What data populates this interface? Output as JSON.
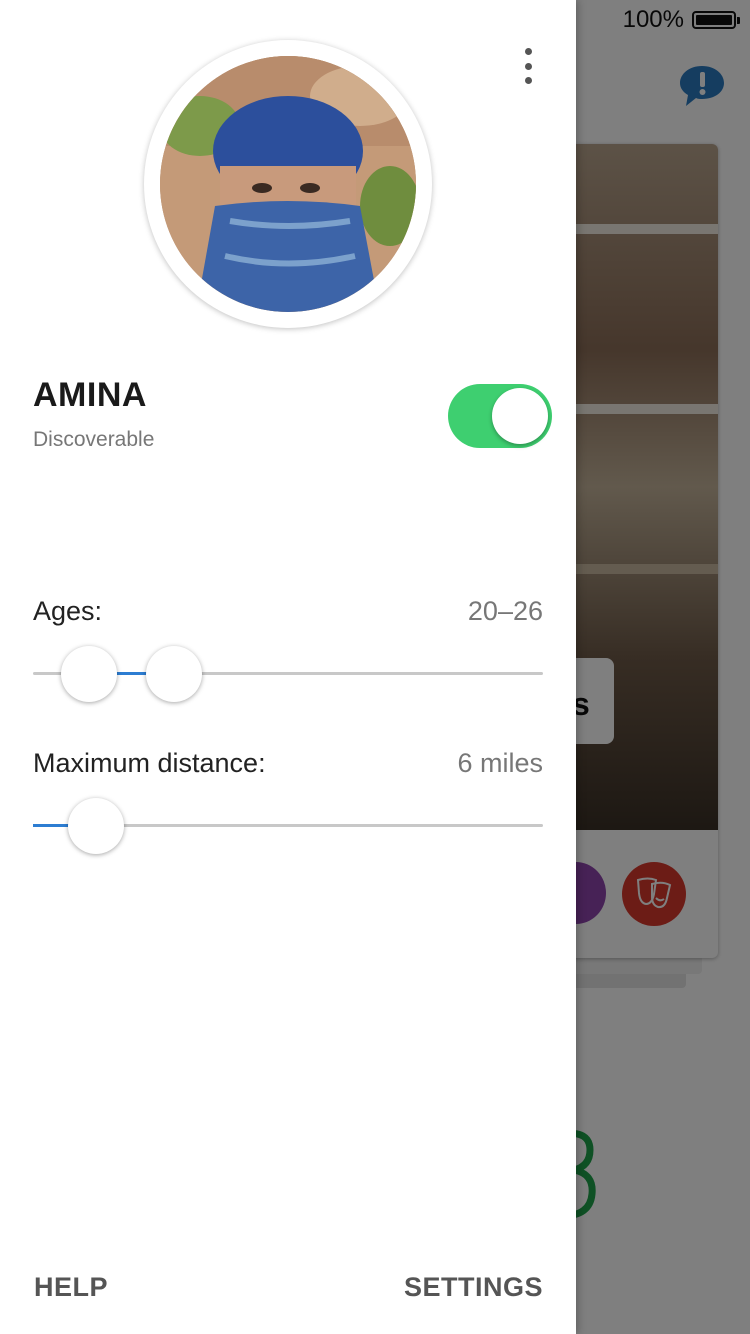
{
  "status_bar": {
    "battery_text": "100%"
  },
  "background_card": {
    "title_fragment": "s"
  },
  "drawer": {
    "profile": {
      "name": "AMINA",
      "status": "Discoverable",
      "discoverable": true
    },
    "ages": {
      "label": "Ages:",
      "value": "20–26",
      "min": 20,
      "max": 26
    },
    "distance": {
      "label": "Maximum distance:",
      "value": "6 miles",
      "miles": 6
    },
    "footer": {
      "help": "HELP",
      "settings": "SETTINGS"
    }
  },
  "colors": {
    "toggle_on": "#3ecf70",
    "slider_fill": "#2d7dd2",
    "chat_icon": "#2a7bc0",
    "tag_theater": "#d9382c",
    "tag_graduate": "#8e44ad"
  },
  "icons": [
    "chat-alert-icon",
    "more-vertical-icon",
    "graduation-cap-icon",
    "theater-masks-icon"
  ]
}
